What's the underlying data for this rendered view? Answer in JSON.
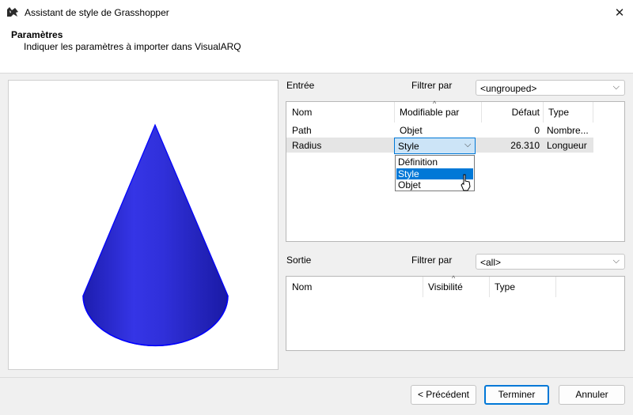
{
  "window": {
    "title": "Assistant de style de Grasshopper",
    "close_icon": "close-icon",
    "app_icon": "rhino-icon"
  },
  "header": {
    "title": "Paramètres",
    "subtitle": "Indiquer les paramètres à importer dans VisualARQ"
  },
  "preview": {
    "object": "cone",
    "color": "#2424d6",
    "edge_color": "#0000ff"
  },
  "entree": {
    "label": "Entrée",
    "filter_label": "Filtrer par",
    "filter_value": "<ungrouped>",
    "columns": [
      "Nom",
      "Modifiable par",
      "Défaut",
      "Type"
    ],
    "rows": [
      {
        "name": "Path",
        "editable": "Objet",
        "default": "0",
        "type": "Nombre..."
      },
      {
        "name": "Radius",
        "editable": "Style",
        "default": "26.310",
        "type": "Longueur"
      }
    ],
    "dropdown": {
      "value": "Style",
      "options": [
        "Définition",
        "Style",
        "Objet"
      ],
      "highlighted": "Style"
    }
  },
  "sortie": {
    "label": "Sortie",
    "filter_label": "Filtrer par",
    "filter_value": "<all>",
    "columns": [
      "Nom",
      "Visibilité",
      "Type"
    ],
    "rows": []
  },
  "buttons": {
    "previous": "< Précédent",
    "finish": "Terminer",
    "cancel": "Annuler"
  },
  "colors": {
    "accent": "#0078d7",
    "row_selected": "#e5e5e5"
  }
}
